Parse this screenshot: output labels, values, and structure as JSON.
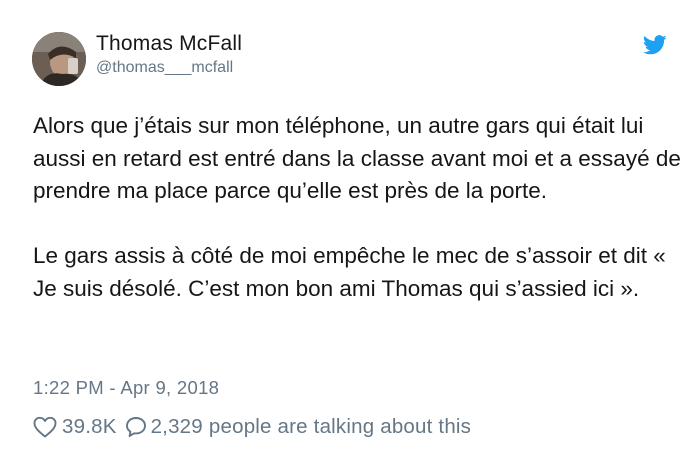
{
  "author": {
    "name": "Thomas McFall",
    "handle": "@thomas___mcfall",
    "avatar": "profile-photo"
  },
  "tweet": {
    "paragraphs": [
      "Alors que j’étais sur mon téléphone, un autre gars qui était lui aussi en retard est entré dans la classe avant moi et a essayé de prendre ma place parce qu’elle est près de la porte.",
      "Le gars assis à côté de moi empêche le mec de s’assoir et dit « Je suis désolé. C’est mon bon ami Thomas qui s’assied ici »."
    ],
    "timestamp": "1:22 PM - Apr 9, 2018"
  },
  "stats": {
    "likes": "39.8K",
    "replies": "2,329",
    "people_label": "people are talking about this"
  },
  "icons": {
    "brand": "twitter-bird-icon",
    "like": "heart-icon",
    "reply": "speech-bubble-icon"
  },
  "colors": {
    "brand": "#1da1f2",
    "text": "#14171a",
    "secondary": "#657786"
  }
}
